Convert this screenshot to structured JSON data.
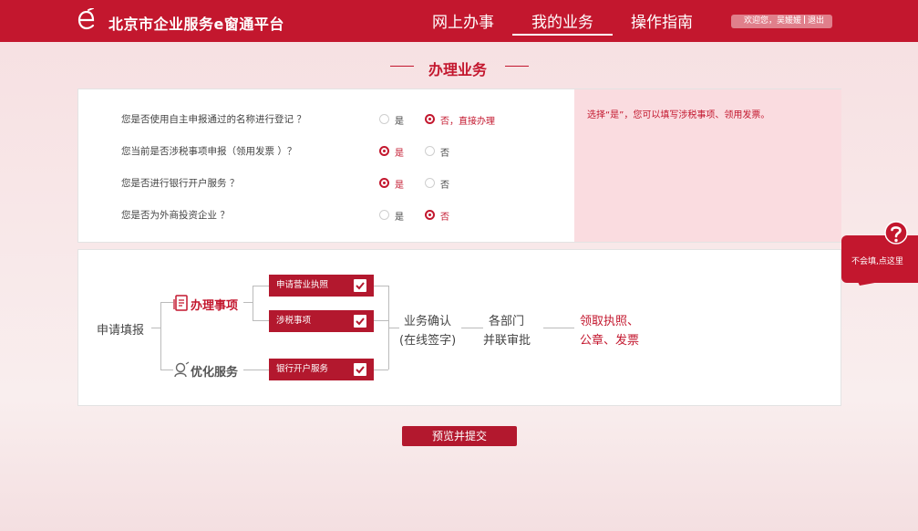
{
  "header": {
    "site_title": "北京市企业服务e窗通平台",
    "nav": [
      "网上办事",
      "我的业务",
      "操作指南"
    ],
    "user_greeting": "欢迎您，吴媛媛",
    "logout": "退出"
  },
  "section_title": "办理业务",
  "questions": [
    {
      "label": "您是否使用自主申报通过的名称进行登记 ？",
      "yes": "是",
      "no": "否，直接办理",
      "selected": "no"
    },
    {
      "label": "您当前是否涉税事项申报（领用发票 ）？",
      "yes": "是",
      "no": "否",
      "selected": "yes"
    },
    {
      "label": "您是否进行银行开户服务 ？",
      "yes": "是",
      "no": "否",
      "selected": "yes"
    },
    {
      "label": "您是否为外商投资企业 ？",
      "yes": "是",
      "no": "否",
      "selected": "no"
    }
  ],
  "hint": "选择“是”，您可以填写涉税事项、领用发票。",
  "flow": {
    "start": "申请填报",
    "group_main": "办理事项",
    "group_opt": "优化服务",
    "services": [
      "申请营业执照",
      "涉税事项",
      "银行开户服务"
    ],
    "confirm_line1": "业务确认",
    "confirm_line2": "(在线签字)",
    "dept_line1": "各部门",
    "dept_line2": "并联审批",
    "result_line1": "领取执照、",
    "result_line2": "公章、发票"
  },
  "help_label": "不会填,点这里",
  "submit_label": "预览并提交",
  "colors": {
    "brand": "#c3172e",
    "button": "#b3182e",
    "hint_bg": "#fadce0"
  }
}
